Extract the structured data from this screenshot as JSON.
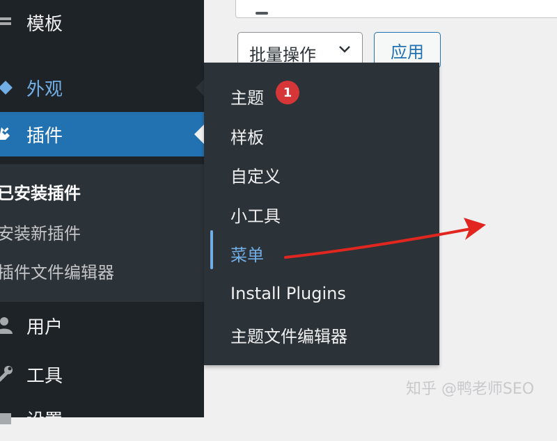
{
  "sidebar": {
    "items": [
      {
        "label": "模板",
        "icon": "template-icon"
      },
      {
        "label": "外观",
        "icon": "appearance-brush-icon"
      },
      {
        "label": "插件",
        "icon": "plugin-icon"
      },
      {
        "label": "用户",
        "icon": "user-icon"
      },
      {
        "label": "工具",
        "icon": "wrench-icon"
      },
      {
        "label": "设置",
        "icon": "settings-icon"
      }
    ],
    "submenu": [
      "已安装插件",
      "安装新插件",
      "插件文件编辑器"
    ]
  },
  "toolbar": {
    "bulk_label": "批量操作",
    "apply_label": "应用"
  },
  "flyout": {
    "items": [
      "主题",
      "样板",
      "自定义",
      "小工具",
      "菜单",
      "Install Plugins",
      "主题文件编辑器"
    ],
    "badge": "1"
  },
  "watermark": "知乎 @鸭老师SEO",
  "colors": {
    "sidebar_bg": "#1d2327",
    "submenu_bg": "#2c3338",
    "accent": "#2271b1",
    "hover_link": "#72aee6",
    "badge": "#d63638",
    "annotation_arrow": "#e0261e"
  }
}
